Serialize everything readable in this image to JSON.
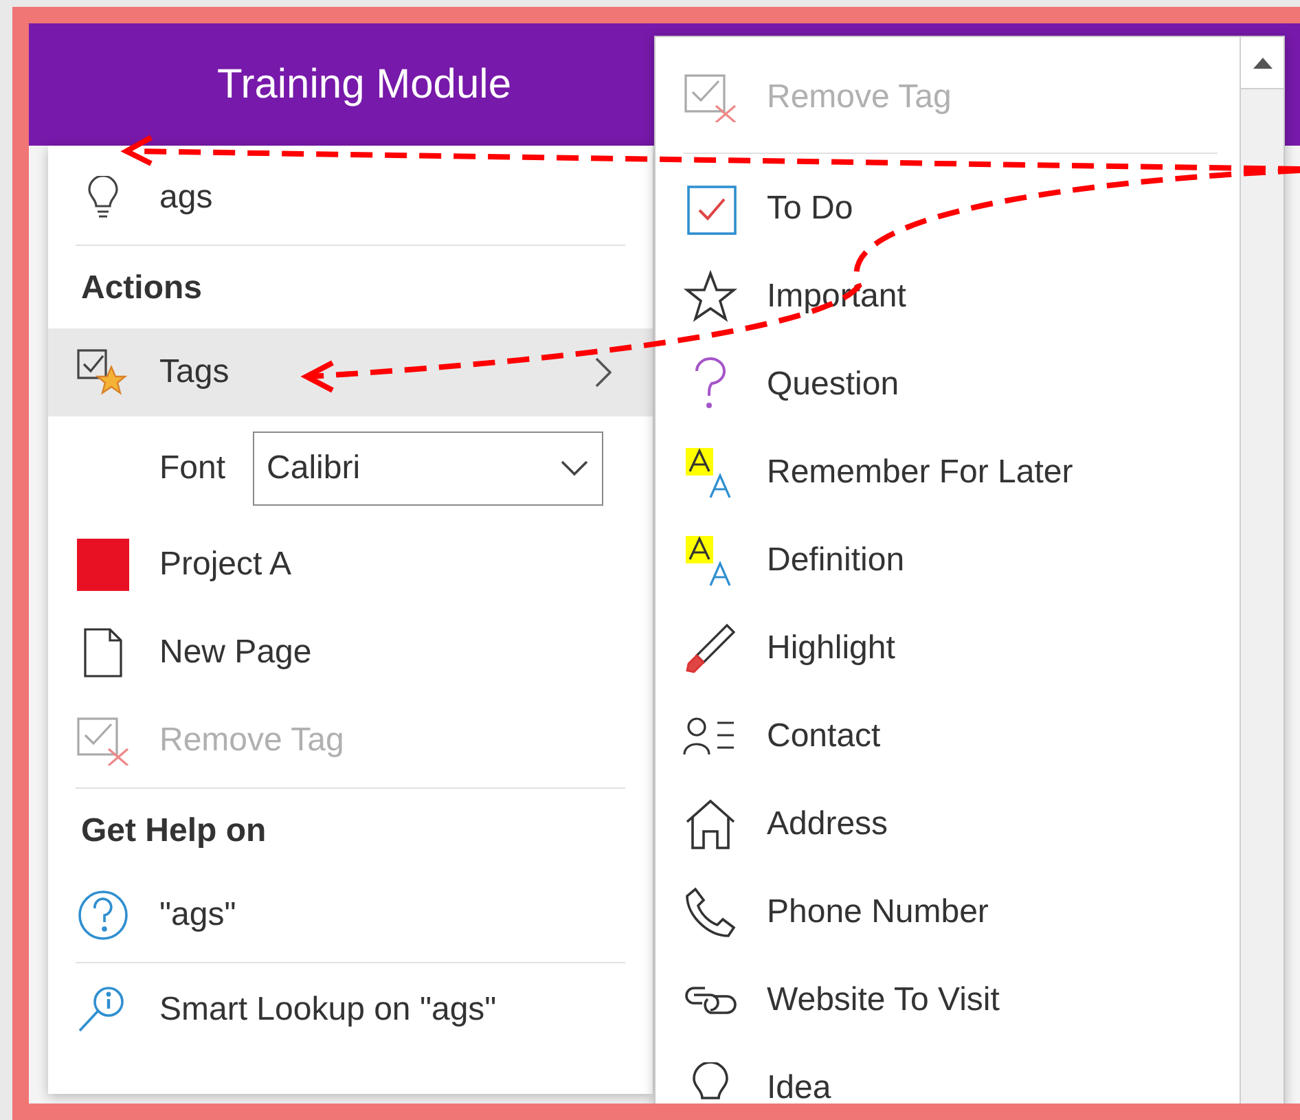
{
  "window": {
    "title": "Training Module"
  },
  "context_menu": {
    "items": [
      {
        "kind": "result",
        "label": "ags"
      },
      {
        "kind": "separator"
      },
      {
        "kind": "heading",
        "label": "Actions"
      },
      {
        "kind": "submenu",
        "label": "Tags",
        "selected": true
      },
      {
        "kind": "font",
        "label": "Font",
        "value": "Calibri"
      },
      {
        "kind": "color",
        "label": "Project A",
        "color": "#e81123"
      },
      {
        "kind": "item",
        "label": "New Page",
        "disabled": false
      },
      {
        "kind": "item",
        "label": "Remove Tag",
        "disabled": true
      },
      {
        "kind": "separator"
      },
      {
        "kind": "heading",
        "label": "Get Help on"
      },
      {
        "kind": "item",
        "label": "\"ags\"",
        "disabled": false
      },
      {
        "kind": "separator"
      },
      {
        "kind": "item",
        "label": "Smart Lookup on \"ags\"",
        "disabled": false
      }
    ]
  },
  "tags_menu": {
    "items": [
      {
        "kind": "item",
        "label": "Remove Tag",
        "disabled": true
      },
      {
        "kind": "separator"
      },
      {
        "kind": "item",
        "label": "To Do",
        "disabled": false
      },
      {
        "kind": "item",
        "label": "Important",
        "disabled": false
      },
      {
        "kind": "item",
        "label": "Question",
        "disabled": false
      },
      {
        "kind": "item",
        "label": "Remember For Later",
        "disabled": false
      },
      {
        "kind": "item",
        "label": "Definition",
        "disabled": false
      },
      {
        "kind": "item",
        "label": "Highlight",
        "disabled": false
      },
      {
        "kind": "item",
        "label": "Contact",
        "disabled": false
      },
      {
        "kind": "item",
        "label": "Address",
        "disabled": false
      },
      {
        "kind": "item",
        "label": "Phone Number",
        "disabled": false
      },
      {
        "kind": "item",
        "label": "Website To Visit",
        "disabled": false
      },
      {
        "kind": "item",
        "label": "Idea",
        "disabled": false
      }
    ]
  }
}
